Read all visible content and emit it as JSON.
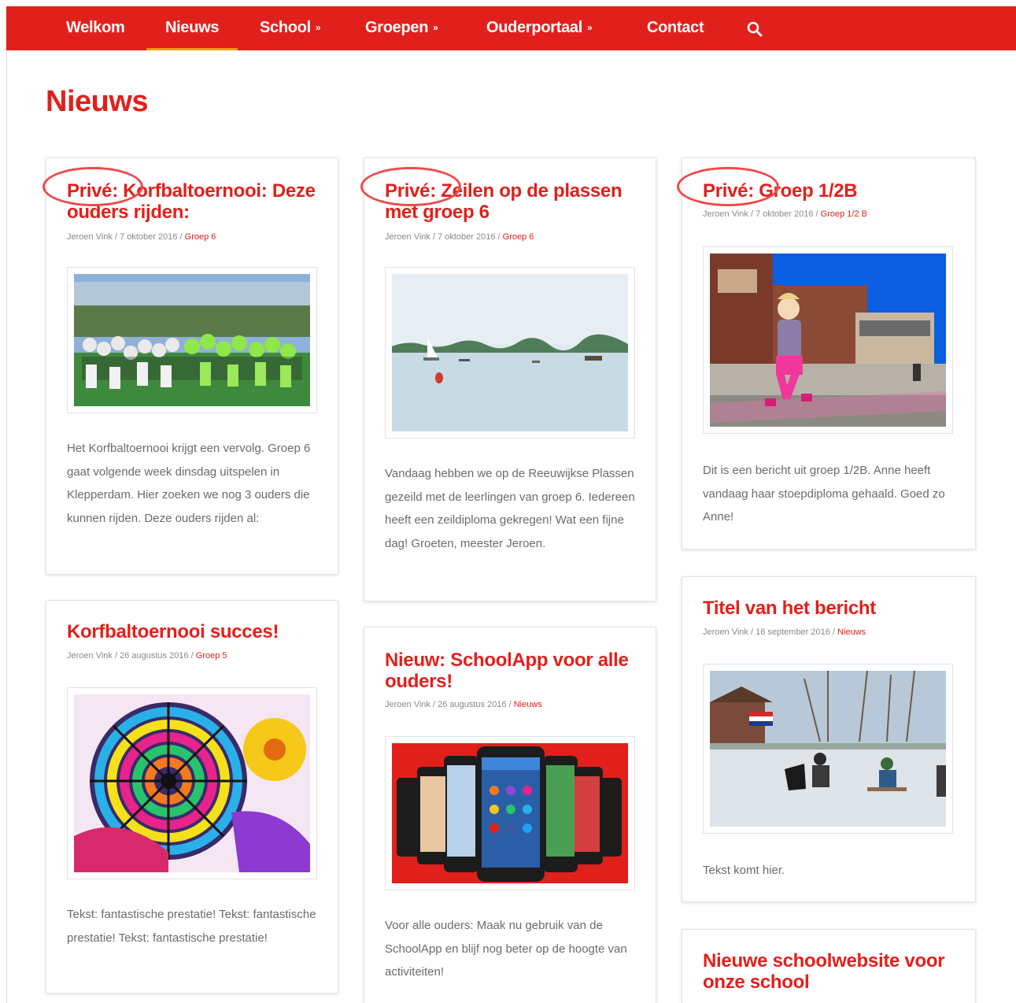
{
  "nav": {
    "items": [
      {
        "label": "Welkom"
      },
      {
        "label": "Nieuws"
      },
      {
        "label": "School"
      },
      {
        "label": "Groepen"
      },
      {
        "label": "Ouderportaal"
      },
      {
        "label": "Contact"
      }
    ],
    "chevron": "»",
    "active": "Nieuws",
    "search_icon": "search-icon"
  },
  "page": {
    "title": "Nieuws"
  },
  "colors": {
    "brand_red": "#e2201b",
    "active_underline": "#f29a1f",
    "annotation_circle": "#ef4a4a"
  },
  "posts": [
    {
      "title": "Privé: Korfbaltoernooi: Deze ouders rijden:",
      "author": "Jeroen Vink",
      "date": "7 oktober 2016",
      "category": "Groep 6",
      "excerpt": "Het Korfbaltoernooi krijgt een vervolg. Groep 6 gaat volgende week dinsdag uitspelen in Klepperdam. Hier zoeken we nog 3 ouders die kunnen rijden. Deze ouders rijden al:"
    },
    {
      "title": "Privé: Zeilen op de plassen met groep 6",
      "author": "Jeroen Vink",
      "date": "7 oktober 2016",
      "category": "Groep 6",
      "excerpt": "Vandaag hebben we op de Reeuwijkse Plassen gezeild met de leerlingen van groep 6. Iedereen heeft een zeildiploma gekregen! Wat een fijne dag! Groeten, meester Jeroen."
    },
    {
      "title": "Privé: Groep 1/2B",
      "author": "Jeroen Vink",
      "date": "7 oktober 2016",
      "category": "Groep 1/2 B",
      "excerpt": "Dit is een bericht uit groep 1/2B. Anne heeft vandaag haar stoepdiploma gehaald. Goed zo Anne!"
    },
    {
      "title": "Korfbaltoernooi succes!",
      "author": "Jeroen Vink",
      "date": "26 augustus 2016",
      "category": "Groep 5",
      "excerpt": "Tekst: fantastische prestatie! Tekst: fantastische prestatie! Tekst: fantastische prestatie!"
    },
    {
      "title": "Nieuw: SchoolApp voor alle ouders!",
      "author": "Jeroen Vink",
      "date": "26 augustus 2016",
      "category": "Nieuws",
      "excerpt": "Voor alle ouders: Maak nu gebruik van de SchoolApp en blijf nog beter op de hoogte van activiteiten!"
    },
    {
      "title": "Titel van het bericht",
      "author": "Jeroen Vink",
      "date": "16 september 2016",
      "category": "Nieuws",
      "excerpt": "Tekst komt hier."
    },
    {
      "title": "Nieuwe schoolwebsite voor onze school",
      "author": "",
      "date": "",
      "category": "",
      "excerpt": ""
    }
  ],
  "meta_separator": "/"
}
